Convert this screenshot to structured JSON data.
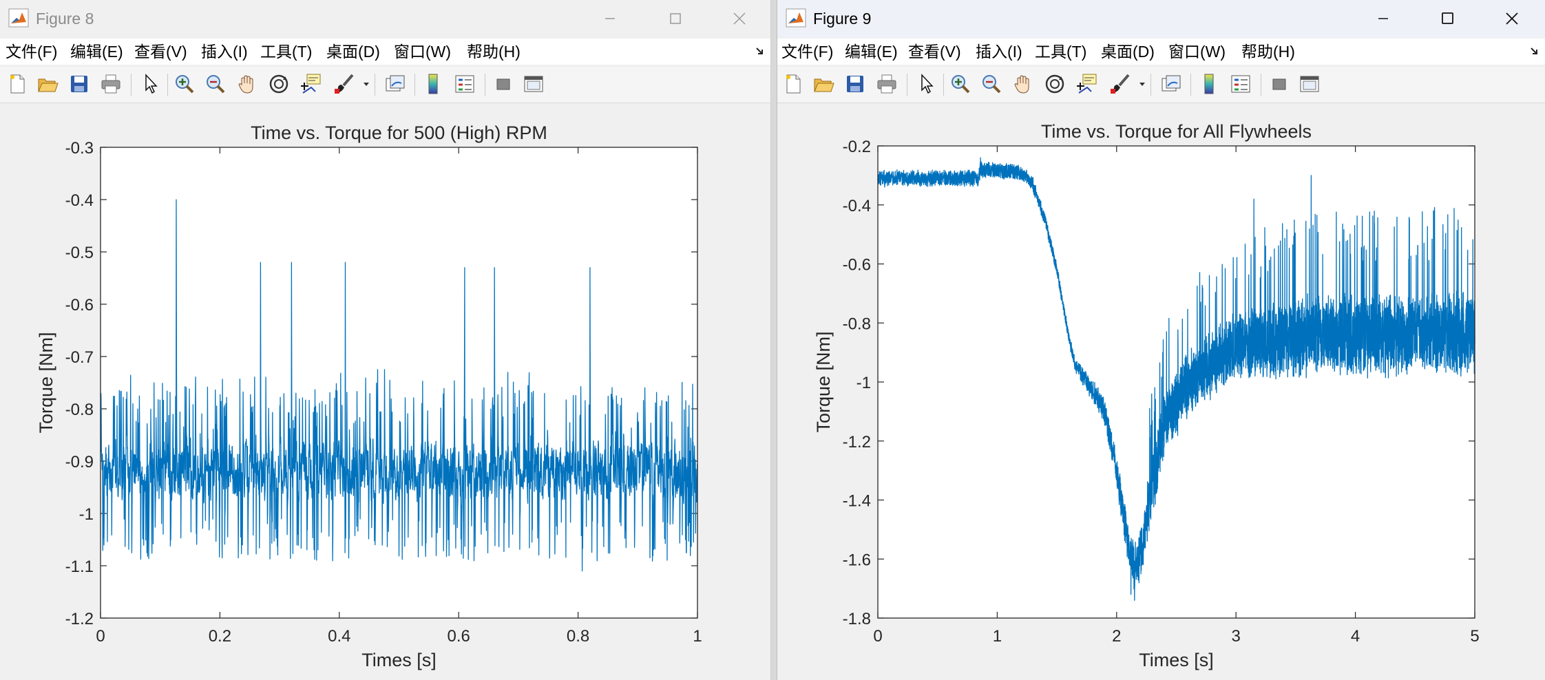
{
  "windows": [
    {
      "title": "Figure 8",
      "menu": [
        "文件(F)",
        "编辑(E)",
        "查看(V)",
        "插入(I)",
        "工具(T)",
        "桌面(D)",
        "窗口(W)",
        "帮助(H)"
      ]
    },
    {
      "title": "Figure 9",
      "menu": [
        "文件(F)",
        "编辑(E)",
        "查看(V)",
        "插入(I)",
        "工具(T)",
        "桌面(D)",
        "窗口(W)",
        "帮助(H)"
      ]
    }
  ],
  "toolbar_icons": [
    "new-figure-icon",
    "open-file-icon",
    "save-icon",
    "print-icon",
    "pointer-icon",
    "zoom-in-icon",
    "zoom-out-icon",
    "pan-hand-icon",
    "rotate-3d-icon",
    "data-cursor-icon",
    "brush-icon",
    "link-plot-icon",
    "colorbar-icon",
    "legend-icon",
    "hide-plot-tools-icon",
    "show-plot-tools-icon"
  ],
  "colors": {
    "line": "#0072BD",
    "axes": "#262626"
  },
  "chart_data": [
    {
      "type": "line",
      "title": "Time vs. Torque for 500 (High) RPM",
      "xlabel": "Times [s]",
      "ylabel": "Torque [Nm]",
      "xlim": [
        0,
        1
      ],
      "ylim": [
        -1.2,
        -0.3
      ],
      "xticks": [
        "0",
        "0.2",
        "0.4",
        "0.6",
        "0.8",
        "1"
      ],
      "yticks": [
        "-1.2",
        "-1.1",
        "-1",
        "-0.9",
        "-0.8",
        "-0.7",
        "-0.6",
        "-0.5",
        "-0.4",
        "-0.3"
      ],
      "grid": false,
      "series": [
        {
          "description": "noisy torque oscillating around the mean with periodic upward spikes",
          "mean": -0.92,
          "lower_envelope": -1.1,
          "typical_spike_max": -0.57,
          "spikes": [
            {
              "x": 0.127,
              "y": -0.4
            },
            {
              "x": 0.268,
              "y": -0.52
            },
            {
              "x": 0.32,
              "y": -0.52
            },
            {
              "x": 0.41,
              "y": -0.52
            },
            {
              "x": 0.61,
              "y": -0.53
            },
            {
              "x": 0.66,
              "y": -0.53
            },
            {
              "x": 0.82,
              "y": -0.53
            }
          ],
          "min_point": {
            "x": 0.807,
            "y": -1.11
          }
        }
      ]
    },
    {
      "type": "line",
      "title": "Time vs. Torque for All Flywheels",
      "xlabel": "Times [s]",
      "ylabel": "Torque [Nm]",
      "xlim": [
        0,
        5
      ],
      "ylim": [
        -1.8,
        -0.2
      ],
      "xticks": [
        "0",
        "1",
        "2",
        "3",
        "4",
        "5"
      ],
      "yticks": [
        "-1.8",
        "-1.6",
        "-1.4",
        "-1.2",
        "-1",
        "-0.8",
        "-0.6",
        "-0.4",
        "-0.2"
      ],
      "grid": false,
      "series": [
        {
          "description": "torque trace across all flywheel speeds",
          "trend_x": [
            0,
            0.84,
            0.86,
            1.2,
            1.3,
            1.4,
            1.5,
            1.6,
            1.65,
            1.7,
            1.8,
            1.9,
            2.0,
            2.1,
            2.15,
            2.2,
            2.3,
            2.4,
            2.6,
            2.8,
            3.0,
            3.5,
            4.0,
            4.5,
            5.0
          ],
          "trend_y": [
            -0.31,
            -0.31,
            -0.28,
            -0.29,
            -0.33,
            -0.45,
            -0.62,
            -0.85,
            -0.94,
            -0.97,
            -1.03,
            -1.1,
            -1.3,
            -1.56,
            -1.63,
            -1.58,
            -1.35,
            -1.15,
            -1.0,
            -0.94,
            -0.88,
            -0.85,
            -0.84,
            -0.84,
            -0.84
          ],
          "noise_amplitude_x": [
            0,
            0.85,
            1.2,
            1.6,
            2.0,
            2.3,
            2.6,
            3.0,
            3.5,
            5.0
          ],
          "noise_amplitude_y": [
            0.03,
            0.03,
            0.03,
            0.02,
            0.06,
            0.12,
            0.12,
            0.12,
            0.15,
            0.15
          ],
          "peaks": [
            {
              "x": 0.86,
              "y": -0.24
            },
            {
              "x": 3.63,
              "y": -0.3
            },
            {
              "x": 3.15,
              "y": -0.38
            },
            {
              "x": 2.12,
              "y": -1.72
            }
          ],
          "min_point": {
            "x": 2.15,
            "y": -1.74
          }
        }
      ]
    }
  ]
}
